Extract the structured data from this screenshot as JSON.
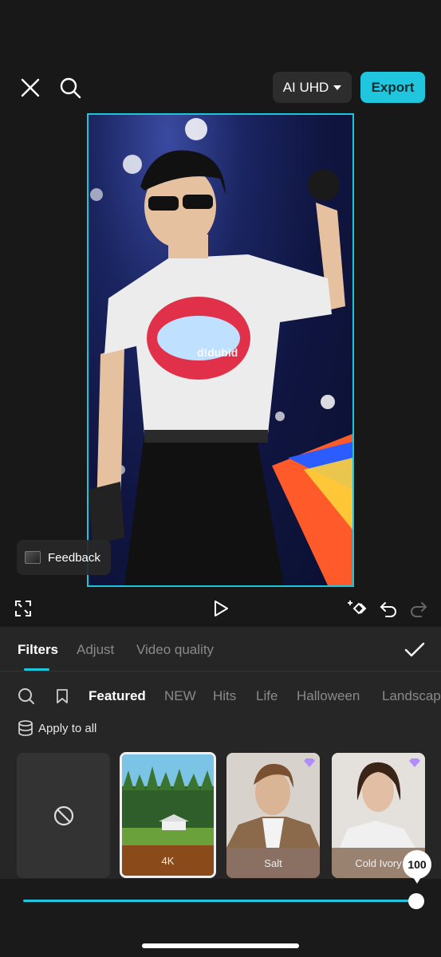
{
  "header": {
    "close_icon": "close-icon",
    "search_icon": "search-icon",
    "quality_label": "AI UHD",
    "export_label": "Export"
  },
  "preview": {
    "watermark": "d!dubid",
    "feedback_label": "Feedback"
  },
  "controls": {
    "fullscreen_icon": "fullscreen-icon",
    "play_icon": "play-icon",
    "keyframe_icon": "keyframe-icon",
    "undo_icon": "undo-icon",
    "redo_icon": "redo-icon"
  },
  "tabs": [
    {
      "label": "Filters",
      "active": true
    },
    {
      "label": "Adjust",
      "active": false
    },
    {
      "label": "Video quality",
      "active": false
    }
  ],
  "categories": [
    "Featured",
    "NEW",
    "Hits",
    "Life",
    "Halloween",
    "Landscape"
  ],
  "apply_to_all": "Apply to all",
  "filters": [
    {
      "label": "",
      "type": "none"
    },
    {
      "label": "4K",
      "selected": true
    },
    {
      "label": "Salt",
      "premium": true
    },
    {
      "label": "Cold Ivory",
      "premium": true
    }
  ],
  "slider": {
    "value": "100",
    "level": 1.0
  },
  "colors": {
    "accent": "#1fc6de",
    "background": "#181818",
    "panel": "#262626"
  }
}
